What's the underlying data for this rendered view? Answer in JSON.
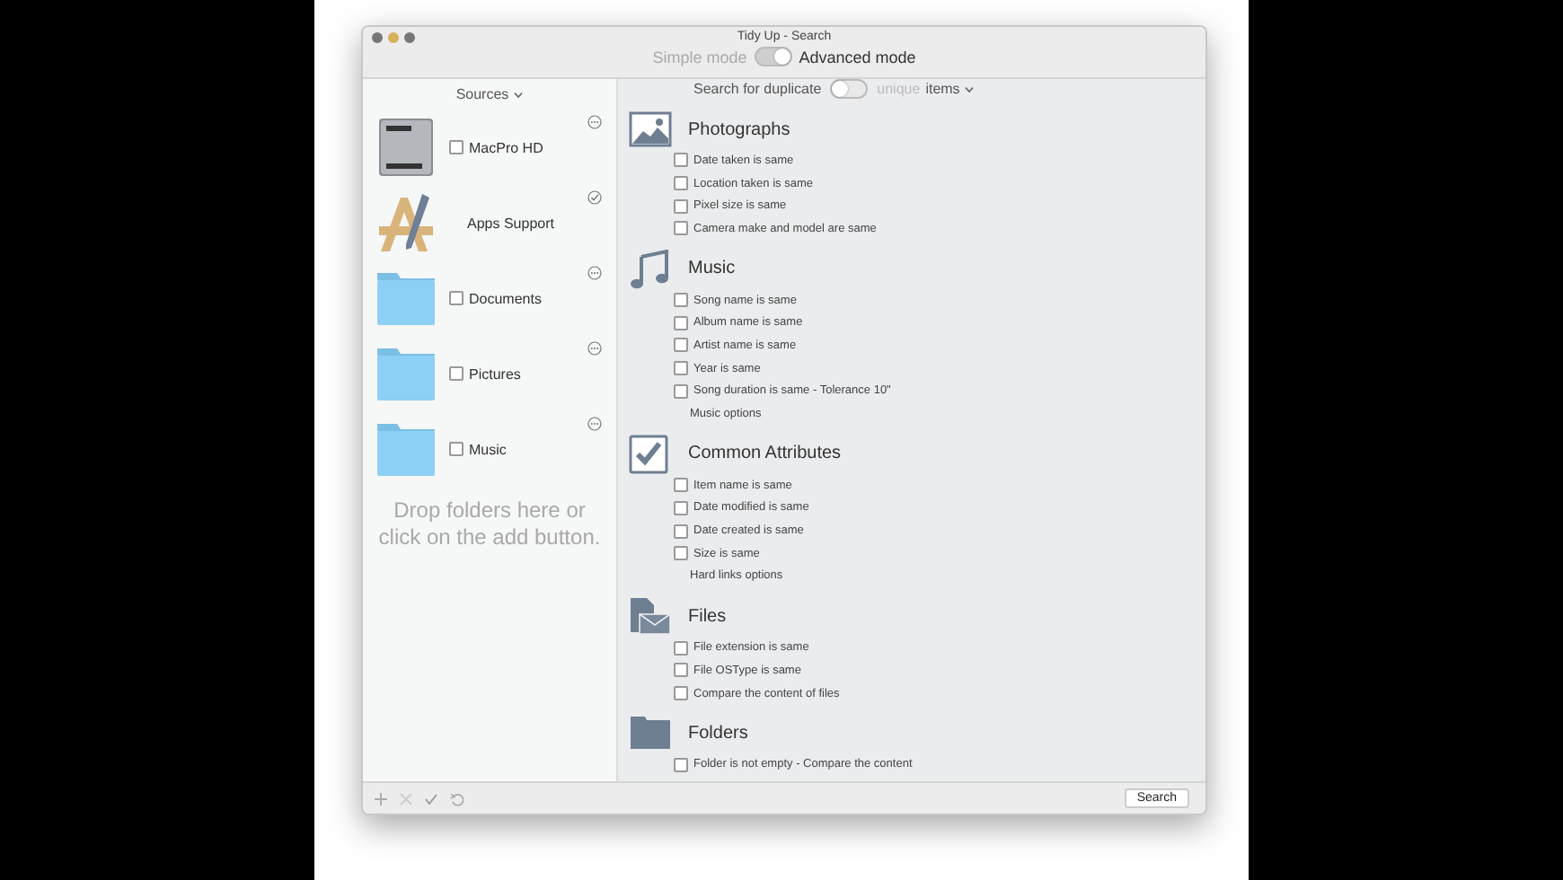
{
  "window": {
    "title": "Tidy Up - Search"
  },
  "mode_switch": {
    "left_label": "Simple mode",
    "right_label": "Advanced mode",
    "on": true
  },
  "sources": {
    "header": "Sources",
    "items": [
      {
        "label": "MacPro HD",
        "kind": "disk",
        "checked": false
      },
      {
        "label": "Apps Support",
        "kind": "app",
        "checked": true
      },
      {
        "label": "Documents",
        "kind": "folder",
        "checked": false
      },
      {
        "label": "Pictures",
        "kind": "folder",
        "checked": false
      },
      {
        "label": "Music",
        "kind": "folder",
        "checked": false
      }
    ],
    "drop_hint": "Drop folders here or click on the add button."
  },
  "search_mode": {
    "prefix": "Search for duplicate",
    "toggle_label": "unique",
    "suffix": "items",
    "on": false
  },
  "sections": [
    {
      "title": "Photographs",
      "kind": "photo",
      "options": [
        {
          "label": "Date taken is same",
          "checked": false
        },
        {
          "label": "Location taken is same",
          "checked": false
        },
        {
          "label": "Pixel size is same",
          "checked": false
        },
        {
          "label": "Camera make and model are same",
          "checked": false
        }
      ]
    },
    {
      "title": "Music",
      "kind": "music",
      "options": [
        {
          "label": "Song name is same",
          "checked": false
        },
        {
          "label": "Album name is same",
          "checked": false
        },
        {
          "label": "Artist name is same",
          "checked": false
        },
        {
          "label": "Year is same",
          "checked": false
        },
        {
          "label": "Song duration is same - Tolerance 10\"",
          "checked": false
        }
      ],
      "link": "Music options"
    },
    {
      "title": "Common Attributes",
      "kind": "check",
      "options": [
        {
          "label": "Item name is same",
          "checked": false
        },
        {
          "label": "Date modified is same",
          "checked": false
        },
        {
          "label": "Date created is same",
          "checked": false
        },
        {
          "label": "Size is same",
          "checked": false
        }
      ],
      "link": "Hard links options"
    },
    {
      "title": "Files",
      "kind": "files",
      "options": [
        {
          "label": "File extension is same",
          "checked": false
        },
        {
          "label": "File OSType is same",
          "checked": false
        },
        {
          "label": "Compare the content of files",
          "checked": false
        }
      ]
    },
    {
      "title": "Folders",
      "kind": "folder",
      "options": [
        {
          "label": "Folder is not empty - Compare the content",
          "checked": false
        }
      ]
    }
  ],
  "search_button": "Search"
}
